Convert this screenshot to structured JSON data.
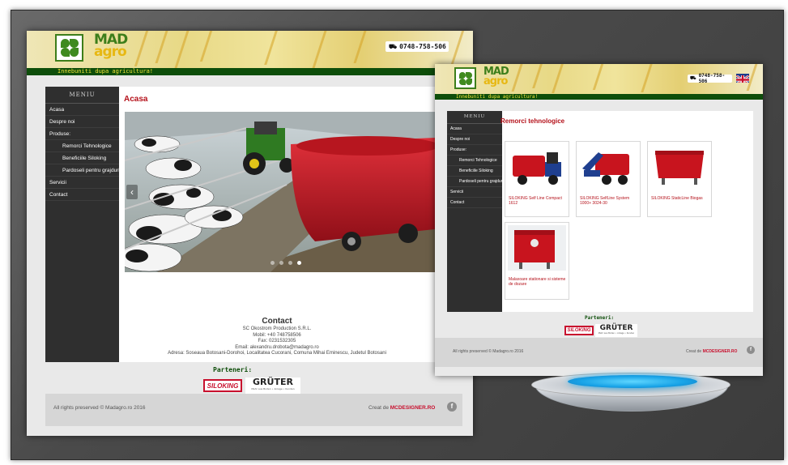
{
  "colors": {
    "accent_red": "#b5121b",
    "brand_green": "#0e4e0a",
    "tagline_yellow": "#f1e33a",
    "sidebar_bg": "#2f2f2f",
    "stand_glow": "#1aa5e8"
  },
  "site1": {
    "logo": {
      "line1": "MAD",
      "line2": "agro"
    },
    "phone": "0748-758-506",
    "tagline": "Innebuniti dupa agricultura!",
    "menu_title": "MENIU",
    "menu": [
      {
        "label": "Acasa",
        "sub": false
      },
      {
        "label": "Despre noi",
        "sub": false
      },
      {
        "label": "Produse:",
        "sub": false
      },
      {
        "label": "Remorci Tehnologice",
        "sub": true
      },
      {
        "label": "Beneficiile Siloking",
        "sub": true
      },
      {
        "label": "Pardoseli pentru grajduri",
        "sub": true
      },
      {
        "label": "Servicii",
        "sub": false
      },
      {
        "label": "Contact",
        "sub": false
      }
    ],
    "page_title": "Acasa",
    "slider": {
      "prev_icon": "chevron-left-icon",
      "dots": 4,
      "active_dot": 3
    },
    "contact": {
      "heading": "Contact",
      "company": "SC Okostrom Production S.R.L.",
      "mobile": "Mobil: +40 748758506",
      "fax": "Fax: 0231532305",
      "email": "Email: alexandru.drobota@madagro.ro",
      "address": "Adresa: Soseaua Botosani-Dorohoi, Localitatea Cucorani, Comuna Mihai Eminescu, Judetul Botosani"
    },
    "partners_title": "Parteneri:",
    "partners": {
      "siloking": "SILOKING",
      "gruter": "GRÜTER",
      "gruter_sub": "Mehr aus Boden • Anlage • Kunden"
    },
    "footer": {
      "copyright": "All rights preserved © Madagro.ro 2016",
      "created_by": "Creat de",
      "designer": "MCDESIGNER.RO",
      "fb_icon": "facebook-icon"
    }
  },
  "site2": {
    "logo": {
      "line1": "MAD",
      "line2": "agro"
    },
    "phone": "0748-758-506",
    "tagline": "Innebuniti dupa agricultura!",
    "menu_title": "MENIU",
    "menu": [
      {
        "label": "Acasa",
        "sub": false
      },
      {
        "label": "Despre noi",
        "sub": false
      },
      {
        "label": "Produse:",
        "sub": false
      },
      {
        "label": "Remorci Tehnologice",
        "sub": true
      },
      {
        "label": "Beneficiile Siloking",
        "sub": true
      },
      {
        "label": "Pardoseli pentru grajduri",
        "sub": true
      },
      {
        "label": "Servicii",
        "sub": false
      },
      {
        "label": "Contact",
        "sub": false
      }
    ],
    "page_title": "Remorci tehnologice",
    "products": [
      {
        "caption": "SILOKING Self Line Compact 1612"
      },
      {
        "caption": "SILOKING SelfLine System 1000+ 3024-30"
      },
      {
        "caption": "SILOKING StaticLine Biogas"
      },
      {
        "caption": "Malaxoare stationare si sisteme de dozare"
      }
    ],
    "partners_title": "Parteneri:",
    "partners": {
      "siloking": "SILOKING",
      "gruter": "GRÜTER",
      "gruter_sub": "Mehr aus Boden • Anlage • Kunden"
    },
    "footer": {
      "copyright": "All rights preserved © Madagro.ro 2016",
      "created_by": "Creat de",
      "designer": "MCDESIGNER.RO",
      "fb_icon": "facebook-icon"
    }
  }
}
